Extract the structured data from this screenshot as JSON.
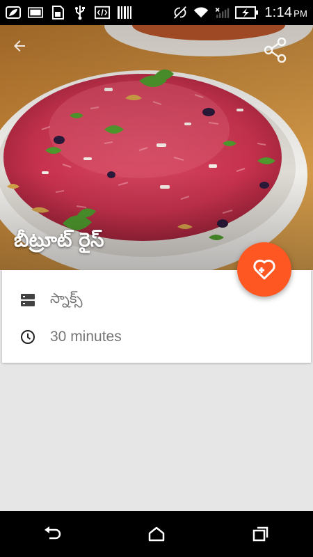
{
  "status_bar": {
    "time": "1:14",
    "ampm": "PM",
    "icons": [
      "leaf-icon",
      "image-icon",
      "sd-card-icon",
      "usb-icon",
      "code-icon",
      "barcode-icon",
      "no-sync-icon",
      "wifi-icon",
      "signal-icon",
      "battery-charging-icon"
    ]
  },
  "app_bar": {
    "back_icon": "arrow-back-icon",
    "share_icon": "share-icon"
  },
  "recipe": {
    "title": "బీట్రూట్ రైస్",
    "category": "స్నాక్స్",
    "time": "30 minutes"
  },
  "fab": {
    "icon": "heart-plus-icon",
    "color": "#ff5722"
  },
  "nav_bar": {
    "icons": [
      "back-icon",
      "home-icon",
      "recents-icon"
    ]
  }
}
